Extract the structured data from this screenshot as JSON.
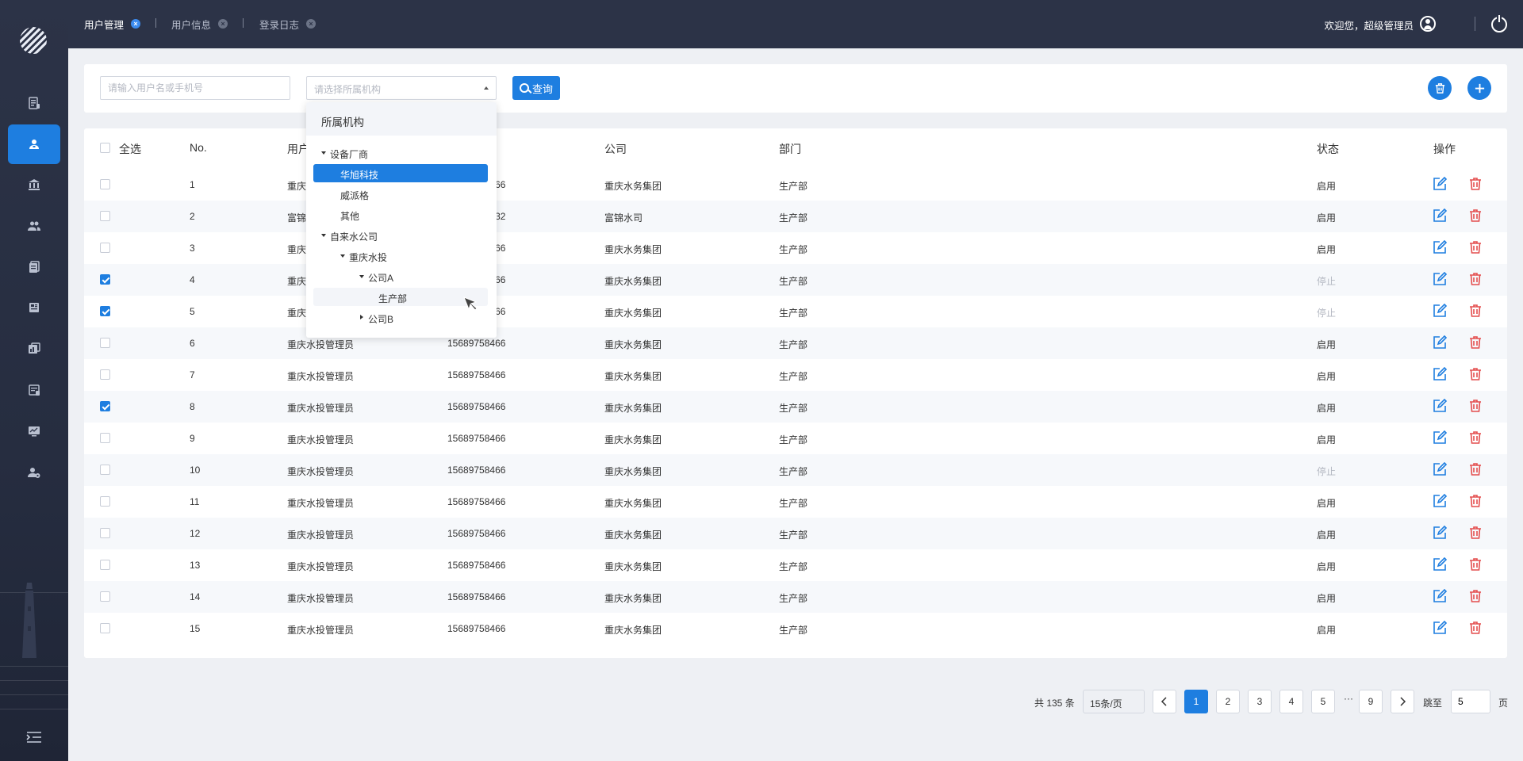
{
  "tabs": [
    {
      "label": "用户管理"
    },
    {
      "label": "用户信息"
    },
    {
      "label": "登录日志"
    }
  ],
  "header": {
    "welcome": "欢迎您，超级管理员"
  },
  "search": {
    "user_placeholder": "请输入用户名或手机号",
    "org_placeholder": "请选择所属机构",
    "query_label": "查询"
  },
  "table": {
    "select_all_label": "全选",
    "columns": [
      "No.",
      "用户",
      "公司",
      "部门",
      "状态",
      "操作"
    ],
    "rows": [
      {
        "no": "1",
        "user": "重庆水投管理员",
        "phone": "15689758466",
        "company": "重庆水务集团",
        "dept": "生产部",
        "status": "启用",
        "checked": false
      },
      {
        "no": "2",
        "user": "富锦水司管理员",
        "phone": "15689758432",
        "company": "富锦水司",
        "dept": "生产部",
        "status": "启用",
        "checked": false
      },
      {
        "no": "3",
        "user": "重庆水投管理员",
        "phone": "15689758466",
        "company": "重庆水务集团",
        "dept": "生产部",
        "status": "启用",
        "checked": false
      },
      {
        "no": "4",
        "user": "重庆水投管理员",
        "phone": "15689758466",
        "company": "重庆水务集团",
        "dept": "生产部",
        "status": "停止",
        "checked": true
      },
      {
        "no": "5",
        "user": "重庆水投管理员",
        "phone": "15689758466",
        "company": "重庆水务集团",
        "dept": "生产部",
        "status": "停止",
        "checked": true
      },
      {
        "no": "6",
        "user": "重庆水投管理员",
        "phone": "15689758466",
        "company": "重庆水务集团",
        "dept": "生产部",
        "status": "启用",
        "checked": false
      },
      {
        "no": "7",
        "user": "重庆水投管理员",
        "phone": "15689758466",
        "company": "重庆水务集团",
        "dept": "生产部",
        "status": "启用",
        "checked": false
      },
      {
        "no": "8",
        "user": "重庆水投管理员",
        "phone": "15689758466",
        "company": "重庆水务集团",
        "dept": "生产部",
        "status": "启用",
        "checked": true
      },
      {
        "no": "9",
        "user": "重庆水投管理员",
        "phone": "15689758466",
        "company": "重庆水务集团",
        "dept": "生产部",
        "status": "启用",
        "checked": false
      },
      {
        "no": "10",
        "user": "重庆水投管理员",
        "phone": "15689758466",
        "company": "重庆水务集团",
        "dept": "生产部",
        "status": "停止",
        "checked": false
      },
      {
        "no": "11",
        "user": "重庆水投管理员",
        "phone": "15689758466",
        "company": "重庆水务集团",
        "dept": "生产部",
        "status": "启用",
        "checked": false
      },
      {
        "no": "12",
        "user": "重庆水投管理员",
        "phone": "15689758466",
        "company": "重庆水务集团",
        "dept": "生产部",
        "status": "启用",
        "checked": false
      },
      {
        "no": "13",
        "user": "重庆水投管理员",
        "phone": "15689758466",
        "company": "重庆水务集团",
        "dept": "生产部",
        "status": "启用",
        "checked": false
      },
      {
        "no": "14",
        "user": "重庆水投管理员",
        "phone": "15689758466",
        "company": "重庆水务集团",
        "dept": "生产部",
        "status": "启用",
        "checked": false
      },
      {
        "no": "15",
        "user": "重庆水投管理员",
        "phone": "15689758466",
        "company": "重庆水务集团",
        "dept": "生产部",
        "status": "启用",
        "checked": false
      }
    ]
  },
  "dropdown": {
    "title": "所属机构",
    "nodes": [
      {
        "label": "设备厂商",
        "expander": "expanded",
        "state": ""
      },
      {
        "label": "华旭科技",
        "expander": "",
        "state": "selected"
      },
      {
        "label": "威派格",
        "expander": "",
        "state": ""
      },
      {
        "label": "其他",
        "expander": "",
        "state": ""
      },
      {
        "label": "自来水公司",
        "expander": "expanded",
        "state": ""
      },
      {
        "label": "重庆水投",
        "expander": "expanded",
        "state": ""
      },
      {
        "label": "公司A",
        "expander": "expanded",
        "state": ""
      },
      {
        "label": "生产部",
        "expander": "",
        "state": "hover"
      },
      {
        "label": "公司B",
        "expander": "collapsed",
        "state": ""
      }
    ]
  },
  "pagination": {
    "total": "共 135 条",
    "page_size": "15条/页",
    "pages": [
      "1",
      "2",
      "3",
      "4",
      "5"
    ],
    "ellipsis": "···",
    "last_page": "9",
    "current": "1",
    "jump_label": "跳至",
    "jump_value": "5",
    "page_suffix": "页"
  },
  "colors": {
    "accent": "#1e7ee0",
    "danger": "#e44e4e",
    "sidebar": "#2c3347"
  },
  "icons": {
    "sidebar": [
      "document-list-icon",
      "user-manage-icon",
      "bank-icon",
      "users-group-icon",
      "files-icon",
      "book-icon",
      "chart-doc-icon",
      "checklist-icon",
      "monitor-chart-icon",
      "user-settings-icon"
    ],
    "row_actions": [
      "edit-icon",
      "delete-icon"
    ],
    "toolbar": [
      "trash-icon",
      "plus-icon"
    ]
  }
}
